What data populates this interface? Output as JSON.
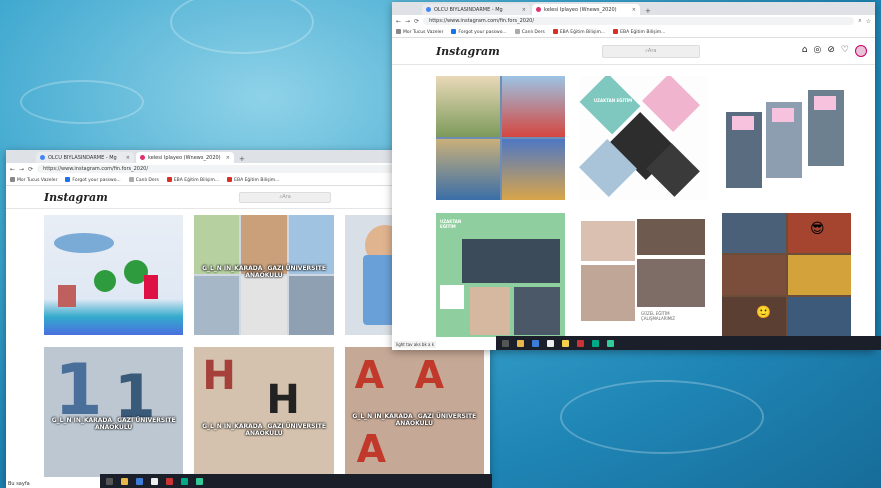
{
  "back_window": {
    "tabs": [
      {
        "label": "OLCU BIYLASINDARME - Mg",
        "color": "#4285f4",
        "active": false
      },
      {
        "label": "kelesi Iplayeo (Wnews_2020)",
        "color": "#e1306c",
        "active": true
      }
    ],
    "url": "https://www.instagram.com/fin.fors_2020/",
    "bookmarks": [
      "Mor Tucus Vazeler",
      "Forgot your passwo...",
      "Canlı Ders",
      "EBA Eğitim Bilişim...",
      "EBA Eğitim Bilişim..."
    ],
    "logo": "Instagram",
    "search_placeholder": "Ara",
    "captions": [
      "",
      "G_L_N IN_KARADA_ GAZI ÜNIVERSITE ANAOKULU",
      "",
      "G_L_N IN_KARADA_ GAZI ÜNIVERSITE ANAOKULU",
      "G_L_N IN_KARADA_ GAZI ÜNIVERSITE ANAOKULU",
      "G_L_N IN_KARADA_ GAZI ÜNIVERSITE ANAOKULU"
    ],
    "status": "Bu sayfa"
  },
  "front_window": {
    "tabs": [
      {
        "label": "OLCU BIYLASINDARME - Mg",
        "color": "#4285f4",
        "active": false
      },
      {
        "label": "kelesi Iplayeo (Wnews_2020)",
        "color": "#e1306c",
        "active": true
      }
    ],
    "url": "https://www.instagram.com/fin.fors_2020/",
    "bookmarks": [
      "Mor Tucus Vazeler",
      "Forgot your passwo...",
      "Canlı Ders",
      "EBA Eğitim Bilişim...",
      "EBA Eğitim Bilişim..."
    ],
    "logo": "Instagram",
    "search_placeholder": "Ara",
    "status": "light tav aks bk a k",
    "tile_texts": [
      "UZAKTAN EĞİTİM",
      "",
      "",
      "UZAKTAN EĞİTİM",
      "",
      "GÜZEL EĞİTİM ÇALIŞMALARIMIZ"
    ]
  },
  "colors": {
    "accent": "#e1306c",
    "taskbar": "#1b1f2a"
  }
}
